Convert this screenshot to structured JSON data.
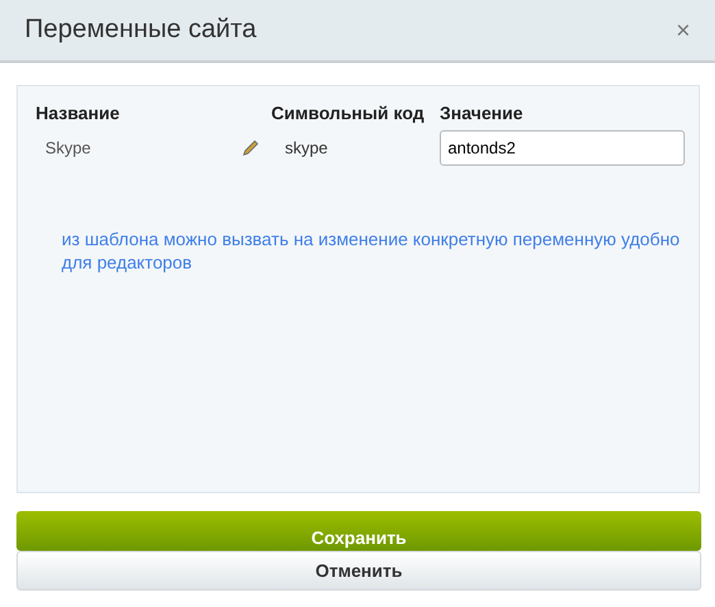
{
  "window": {
    "title": "Переменные сайта",
    "close": "×"
  },
  "table": {
    "columns": [
      "Название",
      "Символьный код",
      "Значение"
    ],
    "rows": [
      {
        "name": "Skype",
        "code": "skype",
        "value": "antonds2"
      }
    ]
  },
  "note": "из шаблона можно вызвать на изменение конкретную переменную удобно для редакторов",
  "buttons": [
    {
      "label": "Сохранить",
      "kind": "primary"
    },
    {
      "label": "Отменить",
      "kind": "secondary"
    }
  ]
}
